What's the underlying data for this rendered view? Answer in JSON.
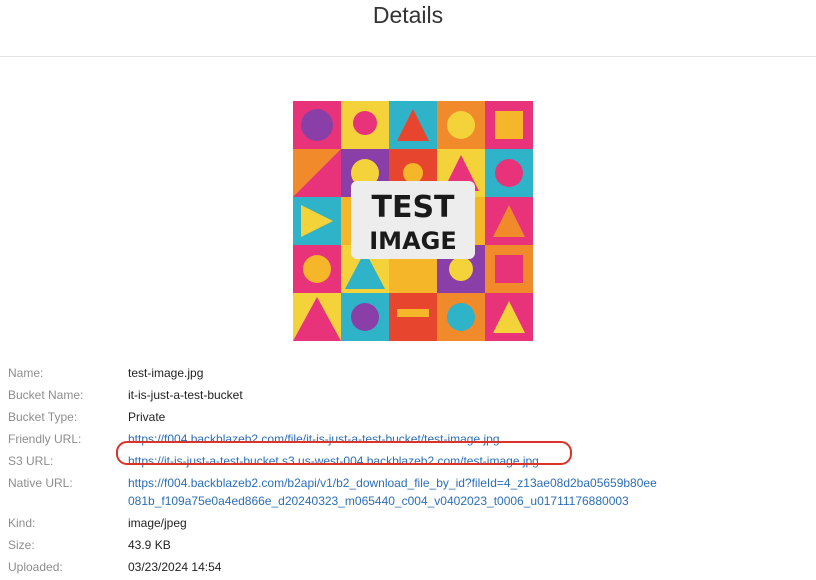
{
  "header": {
    "title": "Details"
  },
  "preview": {
    "text_line1": "TEST",
    "text_line2": "IMAGE"
  },
  "details": {
    "name_label": "Name:",
    "name_value": "test-image.jpg",
    "bucket_name_label": "Bucket Name:",
    "bucket_name_value": "it-is-just-a-test-bucket",
    "bucket_type_label": "Bucket Type:",
    "bucket_type_value": "Private",
    "friendly_url_label": "Friendly URL:",
    "friendly_url_value": "https://f004.backblazeb2.com/file/it-is-just-a-test-bucket/test-image.jpg",
    "s3_url_label": "S3 URL:",
    "s3_url_value": "https://it-is-just-a-test-bucket.s3.us-west-004.backblazeb2.com/test-image.jpg",
    "native_url_label": "Native URL:",
    "native_url_line1": "https://f004.backblazeb2.com/b2api/v1/b2_download_file_by_id?fileId=4_z13ae08d2ba05659b80ee",
    "native_url_line2": "081b_f109a75e0a4ed866e_d20240323_m065440_c004_v0402023_t0006_u01711176880003",
    "kind_label": "Kind:",
    "kind_value": "image/jpeg",
    "size_label": "Size:",
    "size_value": "43.9 KB",
    "uploaded_label": "Uploaded:",
    "uploaded_value": "03/23/2024 14:54"
  },
  "colors": {
    "link": "#2c6eb7",
    "label": "#8e8e8e",
    "highlight_ring": "#d9332b"
  }
}
